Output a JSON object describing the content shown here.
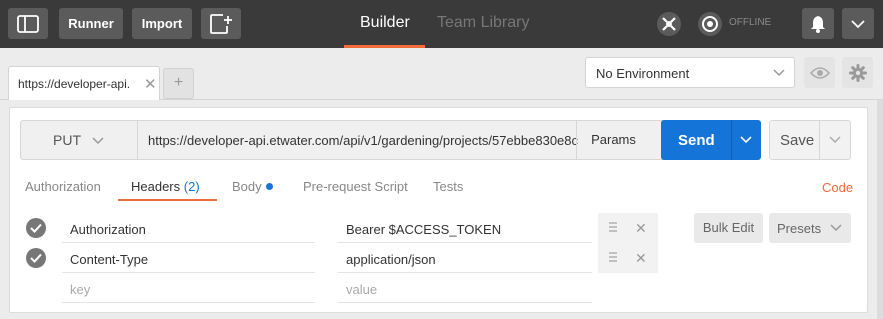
{
  "topbar": {
    "runner_label": "Runner",
    "import_label": "Import",
    "builder_tab": "Builder",
    "team_library_tab": "Team Library",
    "status_text": "OFFLINE"
  },
  "tabs": {
    "request_tab_label": "https://developer-api.",
    "close_glyph": "✕",
    "add_glyph": "+"
  },
  "environment": {
    "selected": "No Environment"
  },
  "request": {
    "method": "PUT",
    "url": "https://developer-api.etwater.com/api/v1/gardening/projects/57ebbe830e8c",
    "params_label": "Params",
    "send_label": "Send",
    "save_label": "Save"
  },
  "subtabs": {
    "authorization": "Authorization",
    "headers": "Headers",
    "headers_count": "(2)",
    "body": "Body",
    "prerequest": "Pre-request Script",
    "tests": "Tests",
    "code": "Code"
  },
  "headers": [
    {
      "key": "Authorization",
      "value": "Bearer $ACCESS_TOKEN"
    },
    {
      "key": "Content-Type",
      "value": "application/json"
    }
  ],
  "new_header": {
    "key_placeholder": "key",
    "value_placeholder": "value"
  },
  "header_actions": {
    "bulk_edit_label": "Bulk Edit",
    "presets_label": "Presets"
  },
  "colors": {
    "accent": "#f26b3a",
    "send": "#1474d8",
    "topbar": "#3a3a3a"
  },
  "icons": [
    "sidebar-toggle-icon",
    "new-window-icon",
    "sync-icon",
    "interceptor-icon",
    "bell-icon",
    "chevron-down-icon",
    "eye-icon",
    "gear-icon",
    "check-icon",
    "drag-handle-icon",
    "close-icon"
  ]
}
